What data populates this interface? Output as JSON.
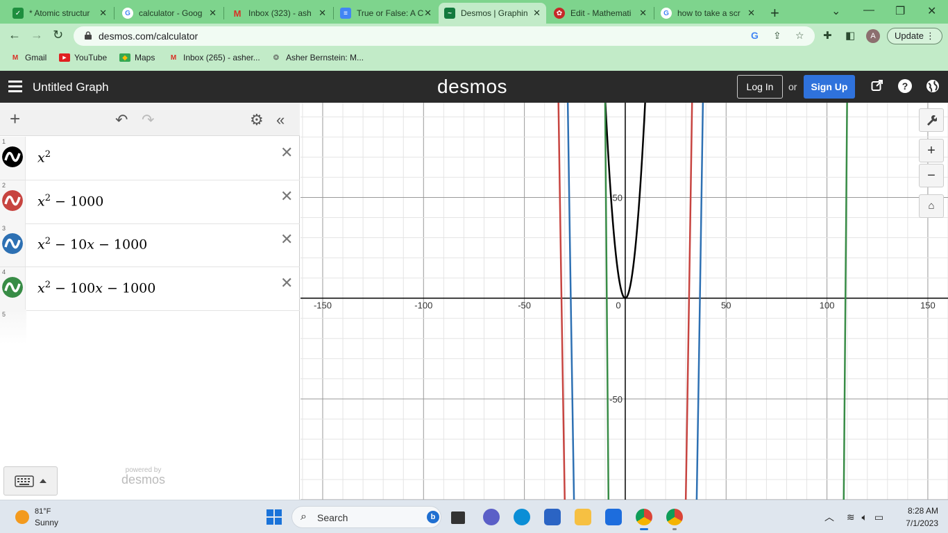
{
  "browser": {
    "tabs": [
      {
        "title": "* Atomic structur",
        "icon": "google-classroom-icon",
        "color": "#1e8e3e"
      },
      {
        "title": "calculator - Goog",
        "icon": "google-icon",
        "color": "#4285f4"
      },
      {
        "title": "Inbox (323) - ash",
        "icon": "gmail-icon",
        "color": "#d93025"
      },
      {
        "title": "True or False: A C",
        "icon": "google-docs-icon",
        "color": "#4285f4"
      },
      {
        "title": "Desmos | Graphin",
        "icon": "desmos-icon",
        "color": "#127a3d",
        "active": true
      },
      {
        "title": "Edit - Mathemati",
        "icon": "edit-icon",
        "color": "#c62828"
      },
      {
        "title": "how to take a scr",
        "icon": "google-icon",
        "color": "#4285f4"
      }
    ],
    "new_tab": "+",
    "url": "desmos.com/calculator",
    "update_label": "Update",
    "profile_initial": "A",
    "bookmarks": [
      {
        "label": "Gmail",
        "icon": "gmail-icon"
      },
      {
        "label": "YouTube",
        "icon": "youtube-icon"
      },
      {
        "label": "Maps",
        "icon": "maps-icon"
      },
      {
        "label": "Inbox (265) - asher...",
        "icon": "gmail-icon"
      },
      {
        "label": "Asher Bernstein: M...",
        "icon": "openai-icon"
      }
    ]
  },
  "desmos": {
    "graph_title": "Untitled Graph",
    "logo": "desmos",
    "login_label": "Log In",
    "or_label": "or",
    "signup_label": "Sign Up",
    "powered_by": "powered by",
    "powered_logo": "desmos",
    "expressions": [
      {
        "num": "1",
        "color": "#000000",
        "latex": "x^2"
      },
      {
        "num": "2",
        "color": "#c74440",
        "latex": "x^2 − 1000"
      },
      {
        "num": "3",
        "color": "#2d70b3",
        "latex": "x^2 − 10x − 1000"
      },
      {
        "num": "4",
        "color": "#388c46",
        "latex": "x^2 − 100x − 1000"
      }
    ],
    "empty_row_num": "5"
  },
  "chart_data": {
    "type": "line",
    "xlim": [
      -161,
      160
    ],
    "ylim": [
      -100,
      97
    ],
    "x_ticks": [
      -150,
      -100,
      -50,
      0,
      50,
      100,
      150
    ],
    "y_ticks": [
      50,
      -50
    ],
    "x_tick_labels": [
      "-150",
      "-100",
      "-50",
      "0",
      "50",
      "100",
      "150"
    ],
    "y_tick_labels": [
      "50",
      "-50"
    ],
    "grid": true,
    "series": [
      {
        "name": "x^2",
        "color": "#000000",
        "coeffs": [
          1,
          0,
          0
        ]
      },
      {
        "name": "x^2 − 1000",
        "color": "#c74440",
        "coeffs": [
          1,
          0,
          -1000
        ]
      },
      {
        "name": "x^2 − 10x − 1000",
        "color": "#2d70b3",
        "coeffs": [
          1,
          -10,
          -1000
        ]
      },
      {
        "name": "x^2 − 100x − 1000",
        "color": "#388c46",
        "coeffs": [
          1,
          -100,
          -1000
        ]
      }
    ]
  },
  "taskbar": {
    "temperature": "81°F",
    "condition": "Sunny",
    "search_placeholder": "Search",
    "time": "8:28 AM",
    "date": "7/1/2023"
  }
}
